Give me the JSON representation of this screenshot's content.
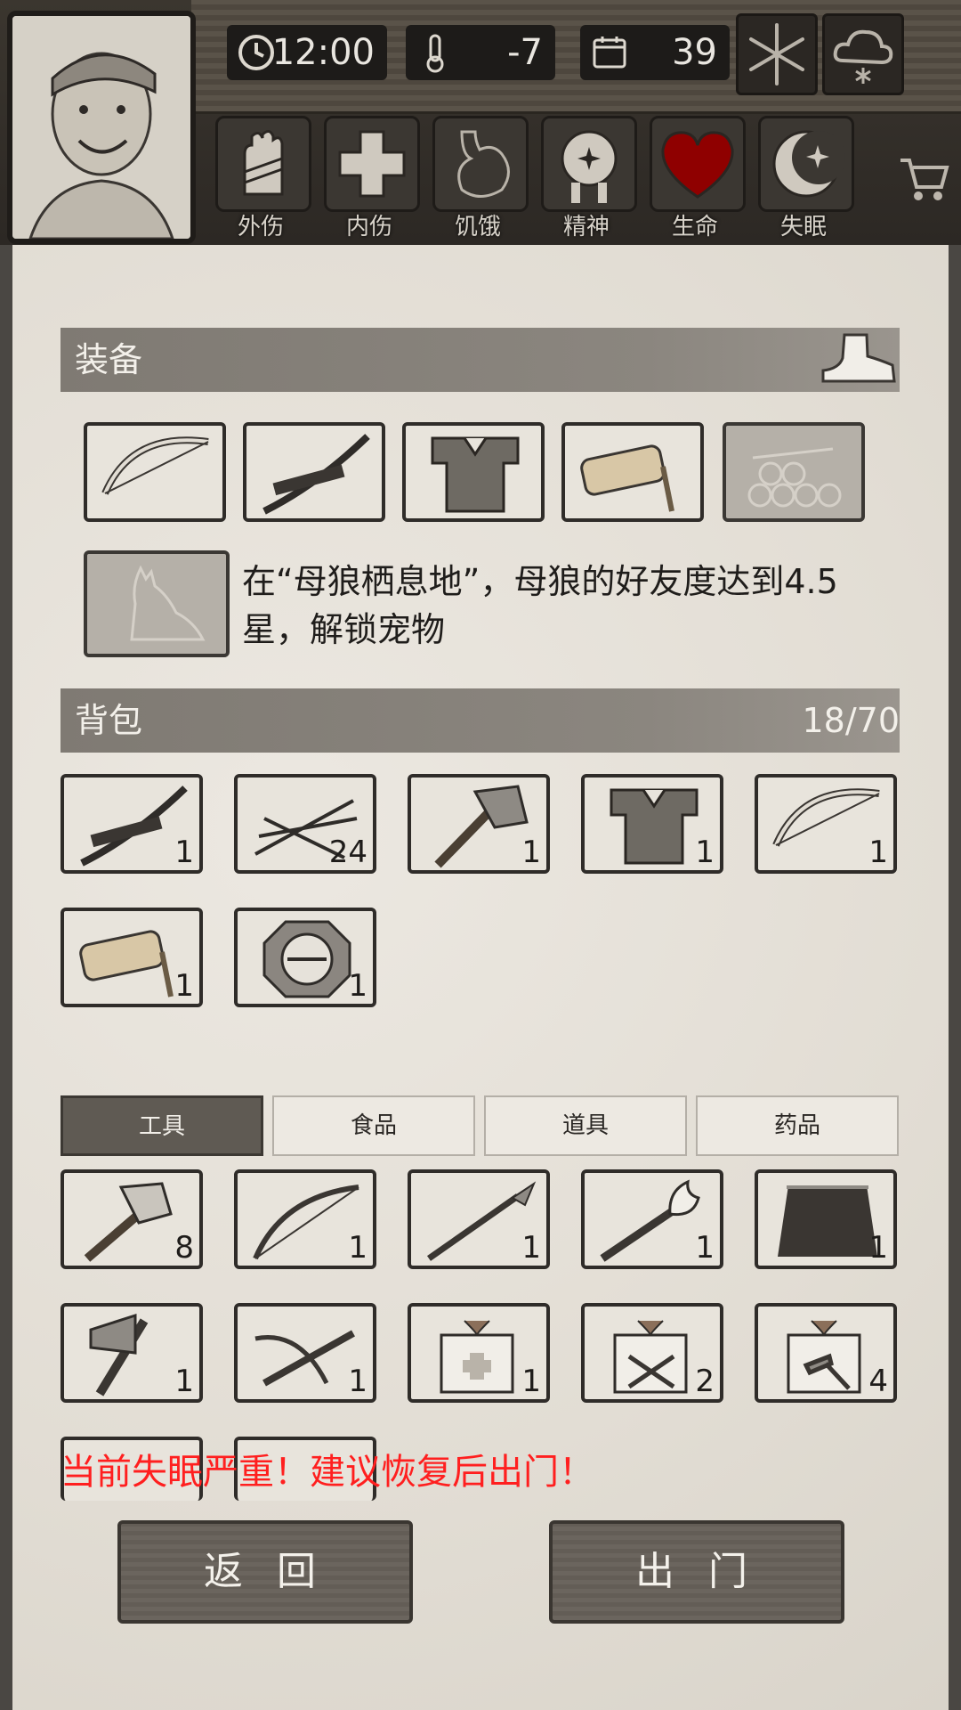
{
  "hud": {
    "time": "12:00",
    "temperature": "-7",
    "day": "39",
    "weather_icons": [
      "snowflake-icon",
      "snow-cloud-icon"
    ],
    "status_labels": [
      "外伤",
      "内伤",
      "饥饿",
      "精神",
      "生命",
      "失眠"
    ],
    "status_icons": [
      "hand-icon",
      "cross-icon",
      "stomach-icon",
      "head-icon",
      "heart-icon",
      "moon-icon"
    ],
    "life_color": "#9b0000"
  },
  "equipment": {
    "title": "装备",
    "slots": [
      "bow",
      "katana",
      "armor",
      "flashlight",
      "logs-locked"
    ],
    "pet_hint": "在“母狼栖息地”，母狼的好友度达到4.5星，解锁宠物"
  },
  "backpack": {
    "title": "背包",
    "count": "18/70",
    "items": [
      {
        "icon": "katana-icon",
        "qty": "1"
      },
      {
        "icon": "arrows-icon",
        "qty": "24"
      },
      {
        "icon": "axe-icon",
        "qty": "1"
      },
      {
        "icon": "armor-icon",
        "qty": "1"
      },
      {
        "icon": "bow-icon",
        "qty": "1"
      },
      {
        "icon": "flashlight-icon",
        "qty": "1"
      },
      {
        "icon": "compass-icon",
        "qty": "1"
      }
    ]
  },
  "tabs": [
    "工具",
    "食品",
    "道具",
    "药品"
  ],
  "storage": {
    "items": [
      {
        "icon": "stone-axe-icon",
        "qty": "8"
      },
      {
        "icon": "crossbow-bow-icon",
        "qty": "1"
      },
      {
        "icon": "spear-icon",
        "qty": "1"
      },
      {
        "icon": "torch-icon",
        "qty": "1"
      },
      {
        "icon": "grass-skirt-icon",
        "qty": "1"
      },
      {
        "icon": "hatchet-icon",
        "qty": "1"
      },
      {
        "icon": "crossbow-icon",
        "qty": "1"
      },
      {
        "icon": "medical-box-icon",
        "qty": "1"
      },
      {
        "icon": "weapon-box-icon",
        "qty": "2"
      },
      {
        "icon": "tool-box-icon",
        "qty": "4"
      }
    ]
  },
  "warning": "当前失眠严重！建议恢复后出门！",
  "buttons": {
    "back": "返 回",
    "go_out": "出 门"
  }
}
